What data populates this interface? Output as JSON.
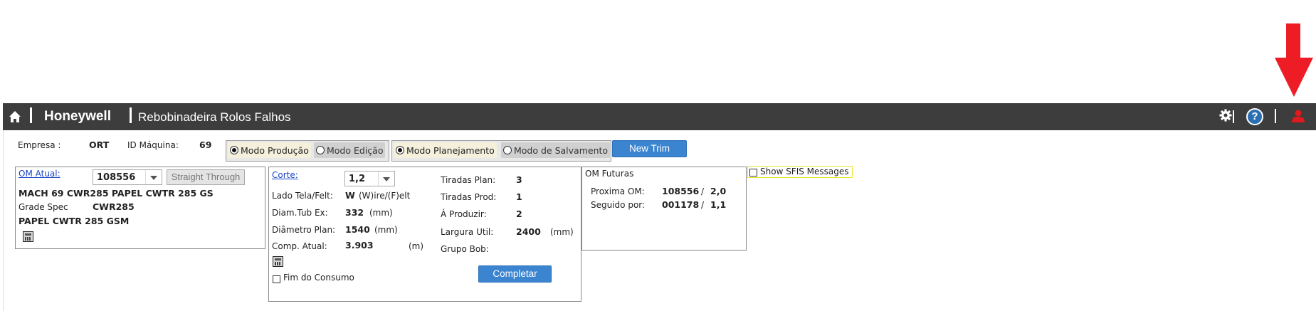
{
  "header": {
    "brand": "Honeywell",
    "title": "Rebobinadeira Rolos Falhos",
    "help_glyph": "?"
  },
  "top": {
    "empresa_label": "Empresa :",
    "empresa_value": "ORT",
    "maquina_label": "ID Máquina:",
    "maquina_value": "69",
    "mode1": {
      "opt1": "Modo Produção",
      "opt2": "Modo Edição",
      "selected": "Modo Produção"
    },
    "mode2": {
      "opt1": "Modo Planejamento",
      "opt2": "Modo de Salvamento",
      "selected": "Modo Planejamento"
    },
    "new_trim": "New Trim"
  },
  "om_panel": {
    "om_atual_label": "OM Atual:",
    "om_atual_value": "108556",
    "straight_through": "Straight Through",
    "line1": "MACH 69 CWR285 PAPEL CWTR 285 GS",
    "grade_label": "Grade Spec",
    "grade_value": "CWR285",
    "line3": "PAPEL CWTR 285 GSM"
  },
  "corte_panel": {
    "corte_label": "Corte:",
    "corte_value": "1,2",
    "lado_label": "Lado Tela/Felt:",
    "lado_value": "W",
    "lado_hint": "(W)ire/(F)elt",
    "diam_tub_label": "Diam.Tub Ex:",
    "diam_tub_value": "332",
    "diam_tub_unit": "(mm)",
    "diam_plan_label": "Diâmetro Plan:",
    "diam_plan_value": "1540",
    "diam_plan_unit": "(mm)",
    "comp_label": "Comp. Atual:",
    "comp_value": "3.903",
    "comp_unit": "(m)",
    "fim_consumo": "Fim do Consumo",
    "tiradas_plan_label": "Tiradas Plan:",
    "tiradas_plan_value": "3",
    "tiradas_prod_label": "Tiradas Prod:",
    "tiradas_prod_value": "1",
    "produzir_label": "Á Produzir:",
    "produzir_value": "2",
    "largura_label": "Largura Util:",
    "largura_value": "2400",
    "largura_unit": "(mm)",
    "grupo_label": "Grupo Bob:",
    "completar": "Completar"
  },
  "futuras_panel": {
    "title": "OM Futuras",
    "proxima_label": "Proxima OM:",
    "proxima_value": "108556",
    "proxima_sep": "/",
    "proxima_corte": "2,0",
    "seguido_label": "Seguido por:",
    "seguido_value": "001178",
    "seguido_sep": "/",
    "seguido_corte": "1,1"
  },
  "sfis": {
    "label": "Show SFIS Messages"
  },
  "colors": {
    "topbar": "#3d3d3d",
    "accent_blue": "#3b84d0",
    "user_icon_red": "#e0191e",
    "arrow_red": "#ee1c25",
    "sfis_border": "#e6e22a"
  }
}
